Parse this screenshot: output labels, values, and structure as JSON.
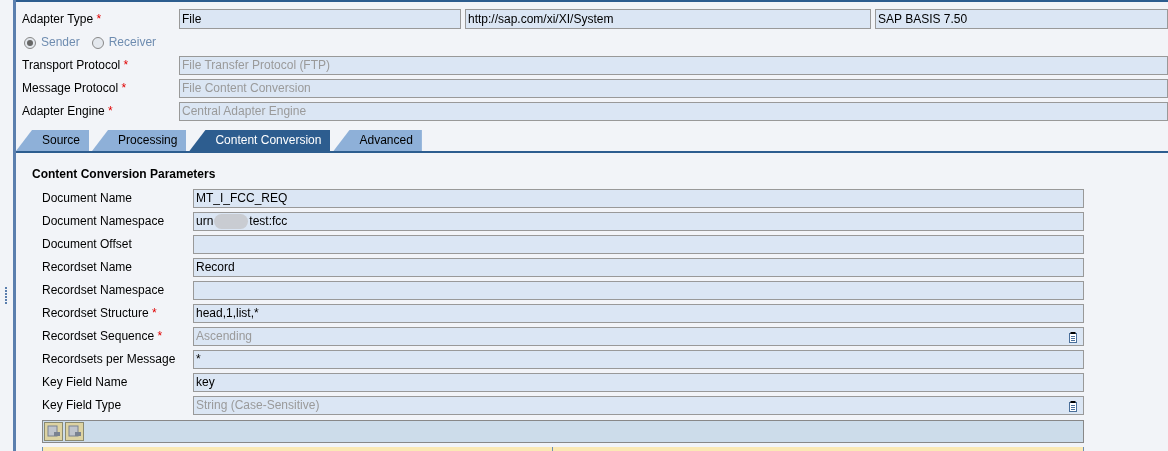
{
  "header": {
    "adapter_type": {
      "label": "Adapter Type",
      "required": true,
      "values": [
        "File",
        "http://sap.com/xi/XI/System",
        "SAP BASIS 7.50"
      ]
    },
    "direction": [
      {
        "label": "Sender",
        "selected": true
      },
      {
        "label": "Receiver",
        "selected": false
      }
    ],
    "fields": [
      {
        "label": "Transport Protocol",
        "required": true,
        "value": "File Transfer Protocol (FTP)",
        "disabled": true
      },
      {
        "label": "Message Protocol",
        "required": true,
        "value": "File Content Conversion",
        "disabled": true
      },
      {
        "label": "Adapter Engine",
        "required": true,
        "value": "Central Adapter Engine",
        "disabled": true
      }
    ]
  },
  "tabs": [
    {
      "label": "Source",
      "selected": false
    },
    {
      "label": "Processing",
      "selected": false
    },
    {
      "label": "Content Conversion",
      "selected": true
    },
    {
      "label": "Advanced",
      "selected": false
    }
  ],
  "section_title": "Content Conversion Parameters",
  "parameters": [
    {
      "kind": "text",
      "label": "Document Name",
      "required": false,
      "value": "MT_I_FCC_REQ",
      "disabled": false
    },
    {
      "kind": "redacted",
      "label": "Document Namespace",
      "required": false,
      "value": "urn",
      "value_end": "test:fcc",
      "disabled": false
    },
    {
      "kind": "text",
      "label": "Document Offset",
      "required": false
    },
    {
      "kind": "text",
      "label": "Recordset Name",
      "required": false,
      "value": "Record",
      "disabled": false
    },
    {
      "kind": "text",
      "label": "Recordset Namespace",
      "required": false
    },
    {
      "kind": "text",
      "label": "Recordset Structure",
      "required": true,
      "value": "head,1,list,*",
      "disabled": false
    },
    {
      "kind": "select",
      "label": "Recordset Sequence",
      "required": true,
      "value": "Ascending",
      "disabled": true
    },
    {
      "kind": "text",
      "label": "Recordsets per Message",
      "required": false,
      "value": "*",
      "disabled": false
    },
    {
      "kind": "text",
      "label": "Key Field Name",
      "required": false,
      "value": "key",
      "disabled": false
    },
    {
      "kind": "select",
      "label": "Key Field Type",
      "required": false,
      "value": "String (Case-Sensitive)",
      "disabled": true
    }
  ]
}
